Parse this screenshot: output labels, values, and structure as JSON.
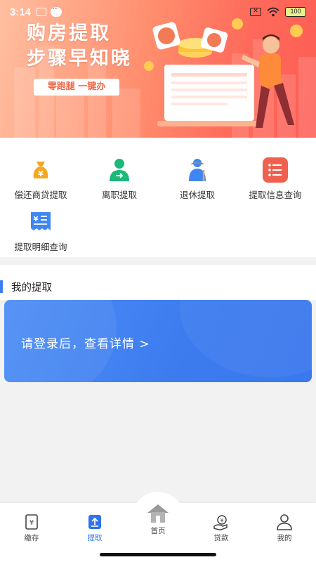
{
  "status_bar": {
    "time": "3:14",
    "battery": "100"
  },
  "banner": {
    "headline_line1": "购房提取",
    "headline_line2": "步骤早知晓",
    "tagline": "零跑腿  一键办"
  },
  "functions": [
    {
      "label": "偿还商贷提取",
      "icon": "money-bag-icon",
      "color": "#f5a623"
    },
    {
      "label": "离职提取",
      "icon": "person-exit-icon",
      "color": "#1cb978"
    },
    {
      "label": "退休提取",
      "icon": "elderly-person-icon",
      "color": "#3e86f2"
    },
    {
      "label": "提取信息查询",
      "icon": "list-icon",
      "color": "#f0604f"
    },
    {
      "label": "提取明细查询",
      "icon": "receipt-icon",
      "color": "#3e86f2"
    }
  ],
  "my_extraction": {
    "section_title": "我的提取",
    "login_prompt": "请登录后，查看详情 >"
  },
  "tabbar": {
    "items": [
      {
        "label": "缴存",
        "icon": "deposit-icon"
      },
      {
        "label": "提取",
        "icon": "withdraw-icon",
        "active": true
      },
      {
        "label": "首页",
        "icon": "home-icon"
      },
      {
        "label": "贷款",
        "icon": "loan-icon"
      },
      {
        "label": "我的",
        "icon": "user-icon"
      }
    ]
  },
  "colors": {
    "accent": "#3e7cf1",
    "banner_start": "#ffbfa0",
    "banner_end": "#fd5d55"
  }
}
